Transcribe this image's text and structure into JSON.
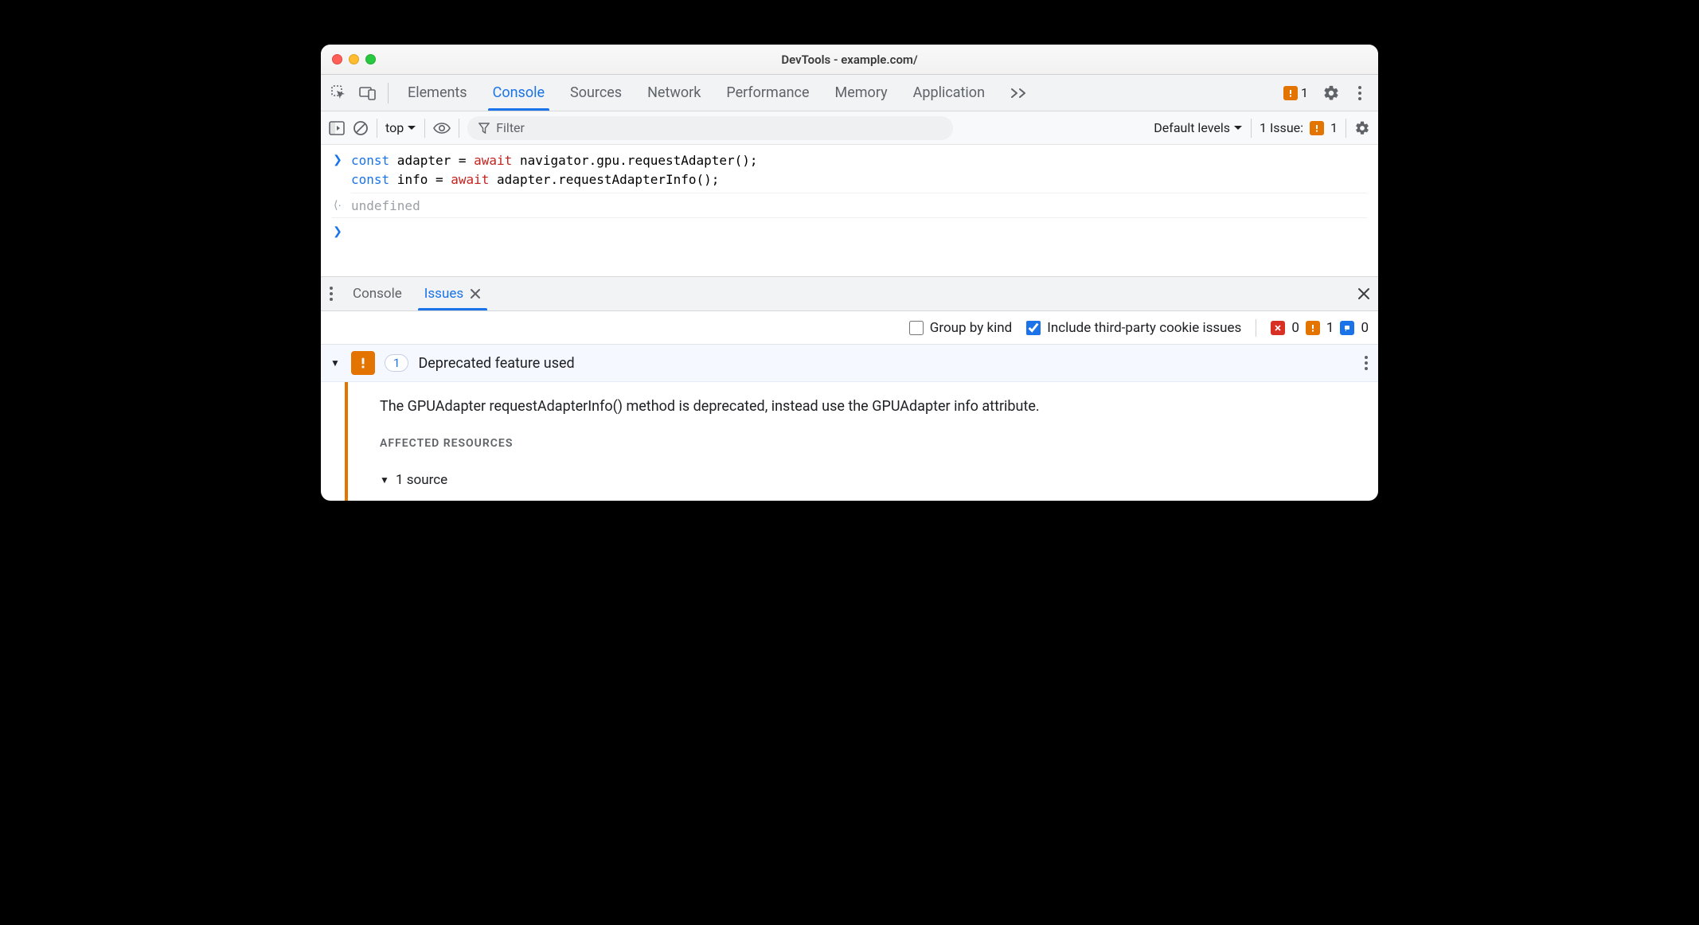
{
  "title": "DevTools - example.com/",
  "tabs": {
    "elements": "Elements",
    "console": "Console",
    "sources": "Sources",
    "network": "Network",
    "performance": "Performance",
    "memory": "Memory",
    "application": "Application"
  },
  "toolbar_issue_count": "1",
  "console": {
    "context": "top",
    "filter_placeholder": "Filter",
    "levels": "Default levels",
    "issues_label": "1 Issue:",
    "issues_count": "1",
    "code_line1_pre": "const",
    "code_line1_var": " adapter = ",
    "code_line1_await": "await",
    "code_line1_rest": " navigator.gpu.requestAdapter();",
    "code_line2_pre": "const",
    "code_line2_var": " info = ",
    "code_line2_await": "await",
    "code_line2_rest": " adapter.requestAdapterInfo();",
    "result": "undefined"
  },
  "drawer": {
    "console_tab": "Console",
    "issues_tab": "Issues",
    "group_by_kind": "Group by kind",
    "include_third_party": "Include third-party cookie issues",
    "count_error": "0",
    "count_warn": "1",
    "count_info": "0"
  },
  "issue": {
    "count": "1",
    "title": "Deprecated feature used",
    "message": "The GPUAdapter requestAdapterInfo() method is deprecated, instead use the GPUAdapter info attribute.",
    "affected_label": "AFFECTED RESOURCES",
    "source_row": "1 source"
  }
}
